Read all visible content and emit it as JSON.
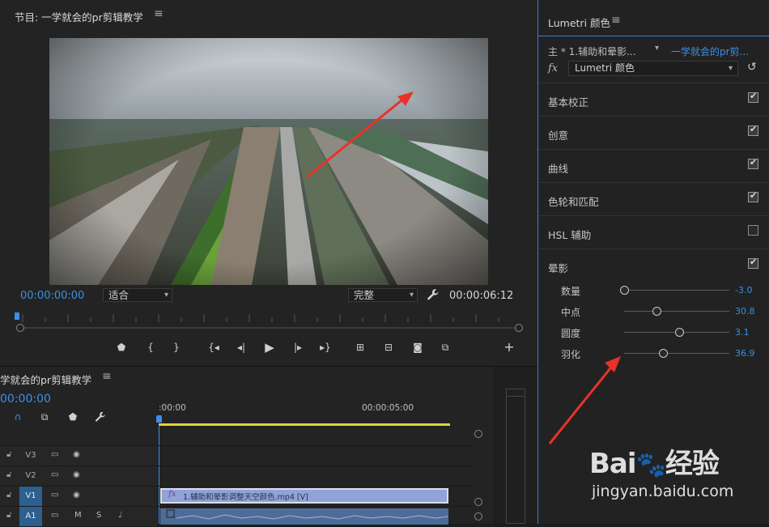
{
  "program": {
    "title": "节目: 一学就会的pr剪辑教学",
    "menu_icon": "hamburger-icon",
    "timecode_current": "00:00:00:00",
    "zoom_value": "适合",
    "quality_value": "完整",
    "timecode_duration": "00:00:06:12",
    "controls": [
      "marker-icon",
      "mark-in-icon",
      "mark-out-icon",
      "go-to-in-icon",
      "step-back-icon",
      "play-icon",
      "step-forward-icon",
      "go-to-out-icon",
      "insert-icon",
      "overwrite-icon",
      "export-frame-icon",
      "compare-icon",
      "add-icon"
    ]
  },
  "lumetri": {
    "title": "Lumetri 颜色",
    "clip_master": "主 * 1.辅助和晕影...",
    "clip_sequence": "一学就会的pr剪...",
    "fx_label": "fx",
    "effect_name": "Lumetri 颜色",
    "sections": [
      {
        "label": "基本校正",
        "checked": true
      },
      {
        "label": "创意",
        "checked": true
      },
      {
        "label": "曲线",
        "checked": true
      },
      {
        "label": "色轮和匹配",
        "checked": true
      },
      {
        "label": "HSL 辅助",
        "checked": false
      },
      {
        "label": "晕影",
        "checked": true
      }
    ],
    "vignette_params": [
      {
        "label": "数量",
        "value": "-3.0",
        "level": 0.0
      },
      {
        "label": "中点",
        "value": "30.8",
        "level": 0.31
      },
      {
        "label": "圆度",
        "value": "3.1",
        "level": 0.52
      },
      {
        "label": "羽化",
        "value": "36.9",
        "level": 0.37
      }
    ]
  },
  "timeline": {
    "title": "学就会的pr剪辑教学",
    "timecode": "00:00:00",
    "ruler_start": ":00:00",
    "ruler_mark": "00:00:05:00",
    "tracks": [
      {
        "name": "V3",
        "active": false
      },
      {
        "name": "V2",
        "active": false
      },
      {
        "name": "V1",
        "active": true
      },
      {
        "name": "A1",
        "active": true
      }
    ],
    "video_clip": {
      "fx": "fx",
      "name": "1.辅助和晕影调整天空颜色.mp4 [V]"
    },
    "audio_toggles": {
      "mute": "M",
      "solo": "S"
    }
  },
  "watermark": {
    "logo": "Bai 经验",
    "url": "jingyan.baidu.com"
  },
  "colors": {
    "accent": "#3b8fe6",
    "arrow": "#e8322a",
    "workarea": "#e0d23a"
  }
}
